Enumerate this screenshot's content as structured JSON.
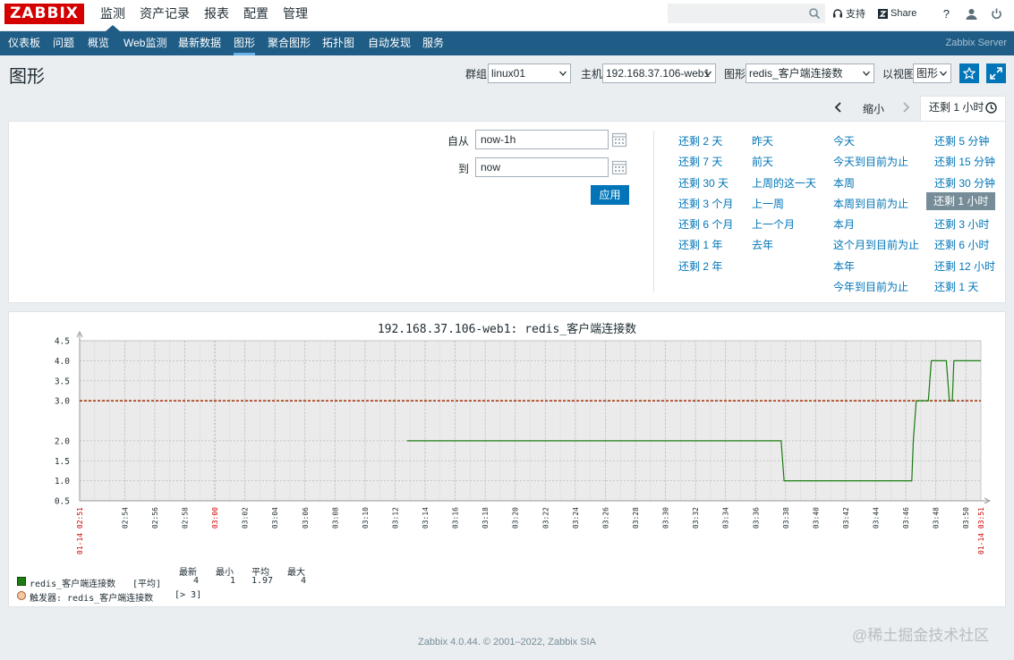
{
  "logo": "ZABBIX",
  "top_menu": [
    {
      "label": "监测",
      "active": true
    },
    {
      "label": "资产记录",
      "active": false
    },
    {
      "label": "报表",
      "active": false
    },
    {
      "label": "配置",
      "active": false
    },
    {
      "label": "管理",
      "active": false
    }
  ],
  "search": {
    "placeholder": ""
  },
  "top_right": {
    "support": "支持",
    "share": "Share",
    "help": "?"
  },
  "sub_menu": [
    {
      "label": "仪表板",
      "active": false
    },
    {
      "label": "问题",
      "active": false
    },
    {
      "label": "概览",
      "active": false
    },
    {
      "label": "Web监测",
      "active": false
    },
    {
      "label": "最新数据",
      "active": false
    },
    {
      "label": "图形",
      "active": true
    },
    {
      "label": "聚合图形",
      "active": false
    },
    {
      "label": "拓扑图",
      "active": false
    },
    {
      "label": "自动发现",
      "active": false
    },
    {
      "label": "服务",
      "active": false
    }
  ],
  "server_name": "Zabbix Server",
  "page_title": "图形",
  "filters": {
    "group_label": "群组",
    "group_value": "linux01",
    "host_label": "主机",
    "host_value": "192.168.37.106-web1",
    "graph_label": "图形",
    "graph_value": "redis_客户端连接数",
    "view_label": "以视图",
    "view_value": "图形"
  },
  "time_nav": {
    "zoom_out": "缩小",
    "tab_label": "还剩 1 小时"
  },
  "time_filter": {
    "from_label": "自从",
    "from_value": "now-1h",
    "to_label": "到",
    "to_value": "now",
    "apply": "应用"
  },
  "quick_ranges": {
    "col1": [
      "还剩 2 天",
      "还剩 7 天",
      "还剩 30 天",
      "还剩 3 个月",
      "还剩 6 个月",
      "还剩 1 年",
      "还剩 2 年"
    ],
    "col2": [
      "昨天",
      "前天",
      "上周的这一天",
      "上一周",
      "上一个月",
      "去年"
    ],
    "col3": [
      "今天",
      "今天到目前为止",
      "本周",
      "本周到目前为止",
      "本月",
      "这个月到目前为止",
      "本年",
      "今年到目前为止"
    ],
    "col4": [
      "还剩 5 分钟",
      "还剩 15 分钟",
      "还剩 30 分钟",
      "还剩 1 小时",
      "还剩 3 小时",
      "还剩 6 小时",
      "还剩 12 小时",
      "还剩 1 天"
    ],
    "selected": "还剩 1 小时"
  },
  "chart_data": {
    "type": "line",
    "title": "192.168.37.106-web1: redis_客户端连接数",
    "ylim": [
      0.5,
      4.5
    ],
    "y_ticks": [
      "4.5",
      "4.0",
      "3.5",
      "3.0",
      "2.0",
      "1.5",
      "1.0",
      "0.5"
    ],
    "y_tick_values": [
      4.5,
      4.0,
      3.5,
      3.0,
      2.0,
      1.5,
      1.0,
      0.5
    ],
    "x_range_minutes": [
      0,
      60
    ],
    "x_start_label": "01-14 02:51",
    "x_end_label": "01-14 03:51",
    "x_ticks": [
      {
        "label": "02:54",
        "t": 3,
        "major": false
      },
      {
        "label": "02:56",
        "t": 5,
        "major": false
      },
      {
        "label": "02:58",
        "t": 7,
        "major": false
      },
      {
        "label": "03:00",
        "t": 9,
        "major": true
      },
      {
        "label": "03:02",
        "t": 11,
        "major": false
      },
      {
        "label": "03:04",
        "t": 13,
        "major": false
      },
      {
        "label": "03:06",
        "t": 15,
        "major": false
      },
      {
        "label": "03:08",
        "t": 17,
        "major": false
      },
      {
        "label": "03:10",
        "t": 19,
        "major": false
      },
      {
        "label": "03:12",
        "t": 21,
        "major": false
      },
      {
        "label": "03:14",
        "t": 23,
        "major": false
      },
      {
        "label": "03:16",
        "t": 25,
        "major": false
      },
      {
        "label": "03:18",
        "t": 27,
        "major": false
      },
      {
        "label": "03:20",
        "t": 29,
        "major": false
      },
      {
        "label": "03:22",
        "t": 31,
        "major": false
      },
      {
        "label": "03:24",
        "t": 33,
        "major": false
      },
      {
        "label": "03:26",
        "t": 35,
        "major": false
      },
      {
        "label": "03:28",
        "t": 37,
        "major": false
      },
      {
        "label": "03:30",
        "t": 39,
        "major": false
      },
      {
        "label": "03:32",
        "t": 41,
        "major": false
      },
      {
        "label": "03:34",
        "t": 43,
        "major": false
      },
      {
        "label": "03:36",
        "t": 45,
        "major": false
      },
      {
        "label": "03:38",
        "t": 47,
        "major": false
      },
      {
        "label": "03:40",
        "t": 49,
        "major": false
      },
      {
        "label": "03:42",
        "t": 51,
        "major": false
      },
      {
        "label": "03:44",
        "t": 53,
        "major": false
      },
      {
        "label": "03:46",
        "t": 55,
        "major": false
      },
      {
        "label": "03:48",
        "t": 57,
        "major": false
      },
      {
        "label": "03:50",
        "t": 59,
        "major": false
      }
    ],
    "series": [
      {
        "name": "redis_客户端连接数",
        "color": "#1a7c11",
        "points": [
          [
            21.8,
            2
          ],
          [
            46.7,
            2
          ],
          [
            46.9,
            1
          ],
          [
            55.4,
            1
          ],
          [
            55.5,
            2
          ],
          [
            55.7,
            3
          ],
          [
            56.5,
            3
          ],
          [
            56.7,
            4
          ],
          [
            57.7,
            4
          ],
          [
            57.9,
            3
          ],
          [
            58.1,
            3
          ],
          [
            58.2,
            4
          ],
          [
            60,
            4
          ]
        ]
      }
    ],
    "trigger": {
      "value": 3.0,
      "color": "#a52a00",
      "label": "触发器: redis_客户端连接数",
      "condition": "[> 3]"
    },
    "legend": {
      "headers": [
        "最新",
        "最小",
        "平均",
        "最大"
      ],
      "item_name": "redis_客户端连接数",
      "item_func": "[平均]",
      "values": [
        "4",
        "1",
        "1.97",
        "4"
      ]
    }
  },
  "footer": "Zabbix 4.0.44. © 2001–2022, Zabbix SIA",
  "watermark": "@稀土掘金技术社区"
}
